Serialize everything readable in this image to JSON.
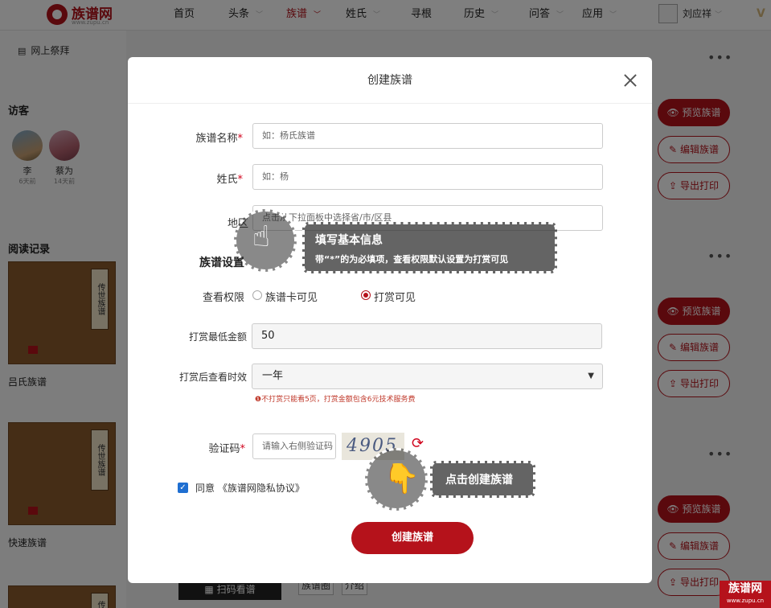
{
  "nav": {
    "logo_text": "族谱网",
    "logo_sub": "www.zupu.cn",
    "items": [
      "首页",
      "头条",
      "族谱",
      "姓氏",
      "寻根",
      "历史",
      "问答",
      "应用"
    ],
    "user": "刘应祥",
    "vip": "V"
  },
  "sidebar": {
    "ancestor_link": "网上祭拜",
    "visitors_title": "访客",
    "visitors": [
      {
        "name": "李",
        "time": "6天前"
      },
      {
        "name": "蔡为",
        "time": "14天前"
      }
    ],
    "reading_title": "阅读记录",
    "books": [
      {
        "name": "吕氏族谱",
        "cover": "传世族谱"
      },
      {
        "name": "快速族谱",
        "cover": "传世族谱"
      },
      {
        "cover": "传"
      }
    ]
  },
  "cards": {
    "preview": "预览族谱",
    "edit": "编辑族谱",
    "export": "导出打印",
    "more": "•••",
    "scan": "扫码看谱",
    "tag1": "族谱圈",
    "tag2": "介绍"
  },
  "corner": {
    "title": "族谱网",
    "sub": "www.zupu.cn"
  },
  "modal": {
    "title": "创建族谱",
    "name_label": "族谱名称",
    "name_placeholder": "如：杨氏族谱",
    "surname_label": "姓氏",
    "surname_placeholder": "如：杨",
    "region_label": "地区",
    "region_placeholder": "点击从下拉面板中选择省/市/区县",
    "settings_title": "族谱设置",
    "view_label": "查看权限",
    "view_option1": "族谱卡可见",
    "view_option2": "打赏可见",
    "min_amount_label": "打赏最低金额",
    "min_amount_value": "50",
    "duration_label": "打赏后查看时效",
    "duration_value": "一年",
    "duration_hint": "❶不打赏只能看5页，打赏金额包含6元技术服务费",
    "captcha_label": "验证码",
    "captcha_placeholder": "请输入右侧验证码",
    "captcha_text": "4905",
    "agree_text": "同意 《族谱网隐私协议》",
    "submit": "创建族谱",
    "required_mark": "*"
  },
  "guide": {
    "tip1_title": "填写基本信息",
    "tip1_sub": "带“*”的为必填项，查看权限默认设置为打赏可见",
    "tip2": "点击创建族谱"
  }
}
